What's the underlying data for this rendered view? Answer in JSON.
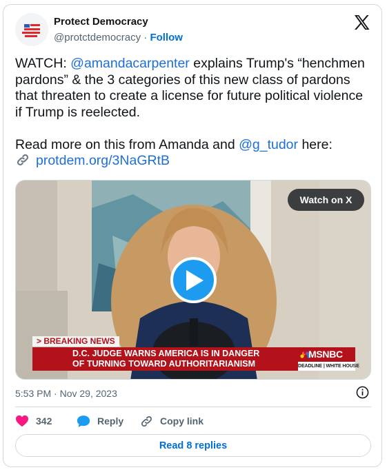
{
  "author": {
    "name": "Protect Democracy",
    "handle": "@protctdemocracy",
    "separator": "·",
    "follow_label": "Follow",
    "avatar_icon": "us-flag-logo-icon"
  },
  "platform_icon": "x-logo-icon",
  "tweet": {
    "line1_prefix": "WATCH: ",
    "line1_mention": "@amandacarpenter",
    "line1_suffix": " explains Trump's “henchmen",
    "line2": "pardons” & the 3 categories of this new class of pardons",
    "line3": "that threaten to create a license for future political violence",
    "line4": "if Trump is reelected.",
    "line5_prefix": "Read more on this from Amanda and ",
    "line5_mention": "@g_tudor",
    "line5_suffix": " here:",
    "link_icon": "link-icon",
    "link_text": "protdem.org/3NaGRtB"
  },
  "media": {
    "watch_label": "Watch on X",
    "play_icon": "play-icon",
    "breaking_label": "> BREAKING NEWS",
    "headline_line1": "D.C. JUDGE WARNS AMERICA IS IN DANGER",
    "headline_line2": "OF TURNING TOWARD AUTHORITARIANISM",
    "network": "MSNBC",
    "show_label": "DEADLINE | WHITE HOUSE"
  },
  "meta": {
    "timestamp": "5:53 PM · Nov 29, 2023",
    "info_icon": "info-icon"
  },
  "actions": {
    "like_count": "342",
    "reply_label": "Reply",
    "copy_label": "Copy link"
  },
  "read_replies_label": "Read 8 replies",
  "colors": {
    "link": "#1d6fd6",
    "like": "#f91880",
    "reply": "#1d9bf0",
    "msnbc_red": "#b3121b",
    "border": "#cfd9de"
  }
}
